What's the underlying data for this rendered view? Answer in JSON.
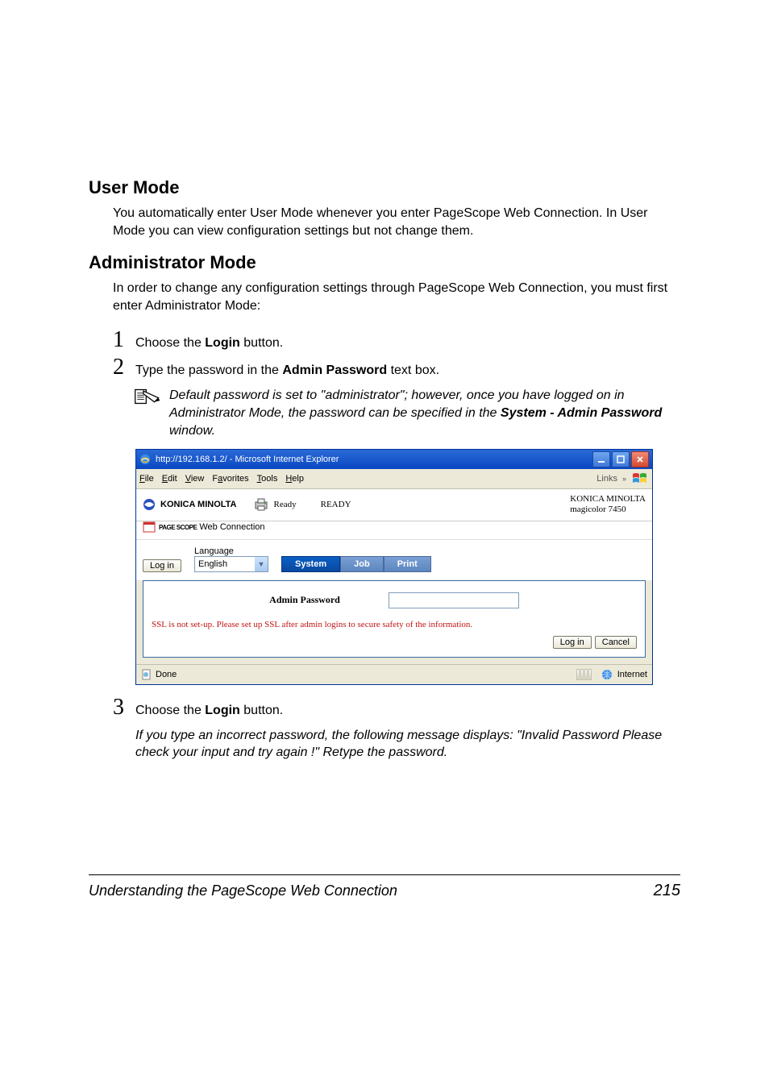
{
  "section1": {
    "heading": "User Mode",
    "body": "You automatically enter User Mode whenever you enter PageScope Web Connection. In User Mode you can view configuration settings but not change them."
  },
  "section2": {
    "heading": "Administrator Mode",
    "body": "In order to change any configuration settings through PageScope Web Connection, you must first enter Administrator Mode:",
    "steps": {
      "s1_pre": "Choose the ",
      "s1_bold": "Login",
      "s1_post": " button.",
      "s2_pre": "Type the password in the ",
      "s2_bold": "Admin Password",
      "s2_post": " text box.",
      "s3_pre": "Choose the ",
      "s3_bold": "Login",
      "s3_post": " button."
    },
    "note_pre": "Default password is set to \"administrator\"; however, once you have logged on in Administrator Mode, the password can be specified in the ",
    "note_bold": "System - Admin Password",
    "note_post": " window.",
    "followup": "If you type an incorrect password, the following message displays: \"Invalid Password Please check your input and try again !\" Retype the password."
  },
  "ie": {
    "title": "http://192.168.1.2/ - Microsoft Internet Explorer",
    "menus": {
      "file": "File",
      "edit": "Edit",
      "view": "View",
      "favorites": "Favorites",
      "tools": "Tools",
      "help": "Help"
    },
    "links": "Links",
    "brand": "KONICA MINOLTA",
    "ready_label": "Ready",
    "ready_status": "READY",
    "device_vendor": "KONICA MINOLTA",
    "device_model": "magicolor 7450",
    "pagescope_small": "PAGE SCOPE",
    "pagescope": "Web Connection",
    "login": "Log in",
    "language_label": "Language",
    "language_value": "English",
    "tabs": {
      "system": "System",
      "job": "Job",
      "print": "Print"
    },
    "admin_label": "Admin Password",
    "ssl": "SSL is not set-up. Please set up SSL after admin logins to secure safety of the information.",
    "btn_login": "Log in",
    "btn_cancel": "Cancel",
    "status_done": "Done",
    "status_zone": "Internet"
  },
  "footer": {
    "title": "Understanding the PageScope Web Connection",
    "page": "215"
  }
}
